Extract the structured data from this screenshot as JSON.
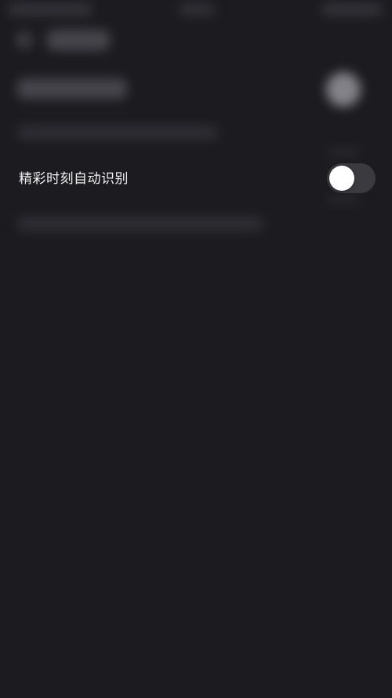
{
  "setting": {
    "label": "精彩时刻自动识别",
    "toggle_state": "off"
  },
  "colors": {
    "background": "#1c1c20",
    "toggle_track_off": "#3a3a3f",
    "toggle_knob": "#ffffff",
    "label_text": "#f2f2f2"
  }
}
